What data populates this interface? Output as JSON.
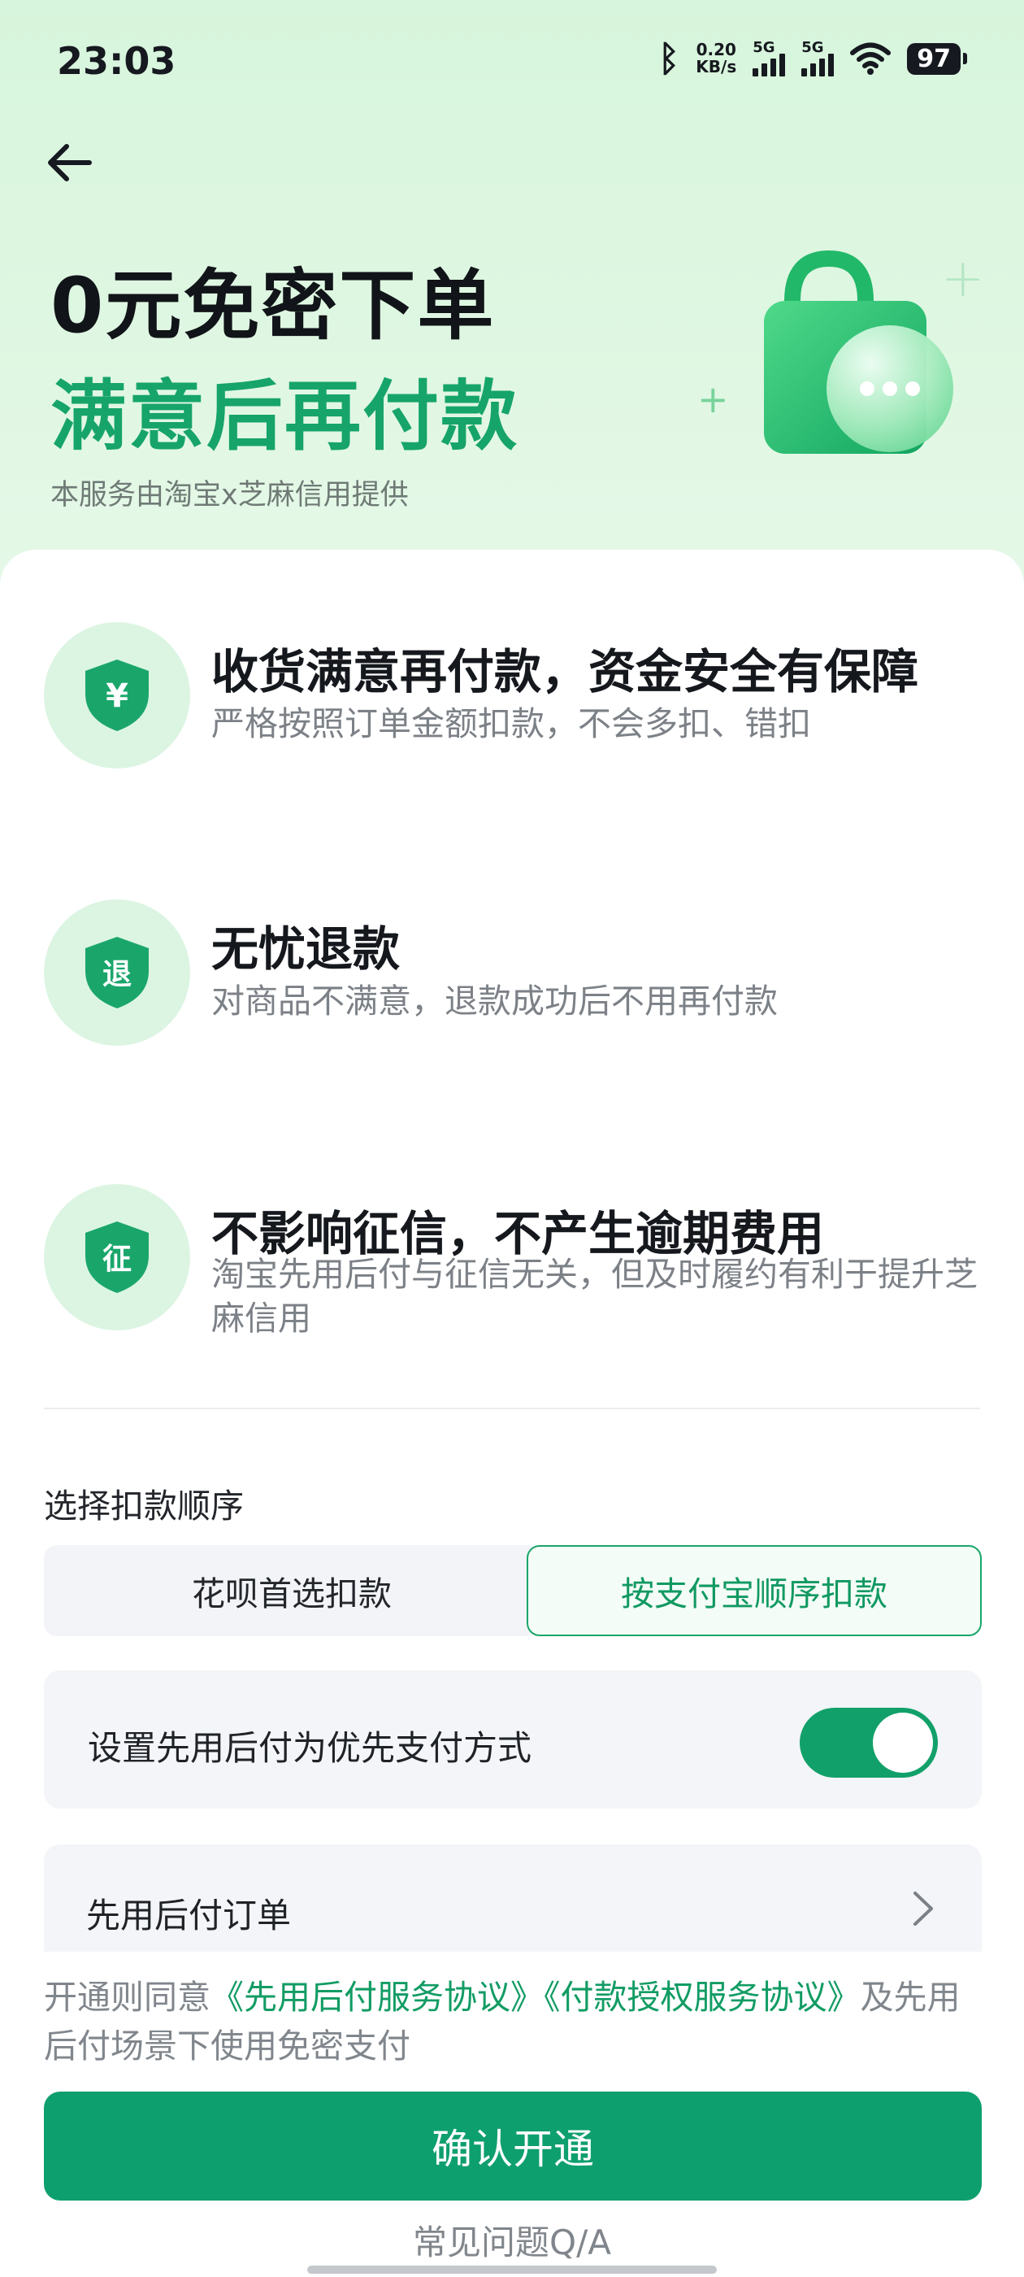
{
  "status_bar": {
    "time": "23:03",
    "net_speed_value": "0.20",
    "net_speed_unit": "KB/s",
    "sim1_label": "5G",
    "sim2_label": "5G",
    "battery": "97"
  },
  "header": {
    "back_icon": "arrow-left-icon",
    "title_line1": "0元免密下单",
    "title_line2": "满意后再付款",
    "subtitle": "本服务由淘宝x芝麻信用提供",
    "illustration": "green-shopping-bag-with-chat-bubble"
  },
  "features": [
    {
      "icon_glyph": "¥",
      "title": "收货满意再付款，资金安全有保障",
      "desc": "严格按照订单金额扣款，不会多扣、错扣"
    },
    {
      "icon_glyph": "退",
      "title": "无忧退款",
      "desc": "对商品不满意，退款成功后不用再付款"
    },
    {
      "icon_glyph": "征",
      "title": "不影响征信，不产生逾期费用",
      "desc": "淘宝先用后付与征信无关，但及时履约有利于提升芝麻信用"
    }
  ],
  "deduction": {
    "label": "选择扣款顺序",
    "option_a": "花呗首选扣款",
    "option_b": "按支付宝顺序扣款",
    "selected": "按支付宝顺序扣款"
  },
  "priority": {
    "label": "设置先用后付为优先支付方式",
    "enabled": true
  },
  "orders": {
    "label": "先用后付订单"
  },
  "agreement": {
    "prefix": "开通则同意",
    "link1": "《先用后付服务协议》",
    "link2": "《付款授权服务协议》",
    "suffix": "及先用后付场景下使用免密支付"
  },
  "confirm_button": "确认开通",
  "faq_link": "常见问题Q/A",
  "colors": {
    "accent": "#0e9f6e",
    "hero_bg": "#d7f5dc",
    "badge_bg": "#dcf5e3"
  }
}
